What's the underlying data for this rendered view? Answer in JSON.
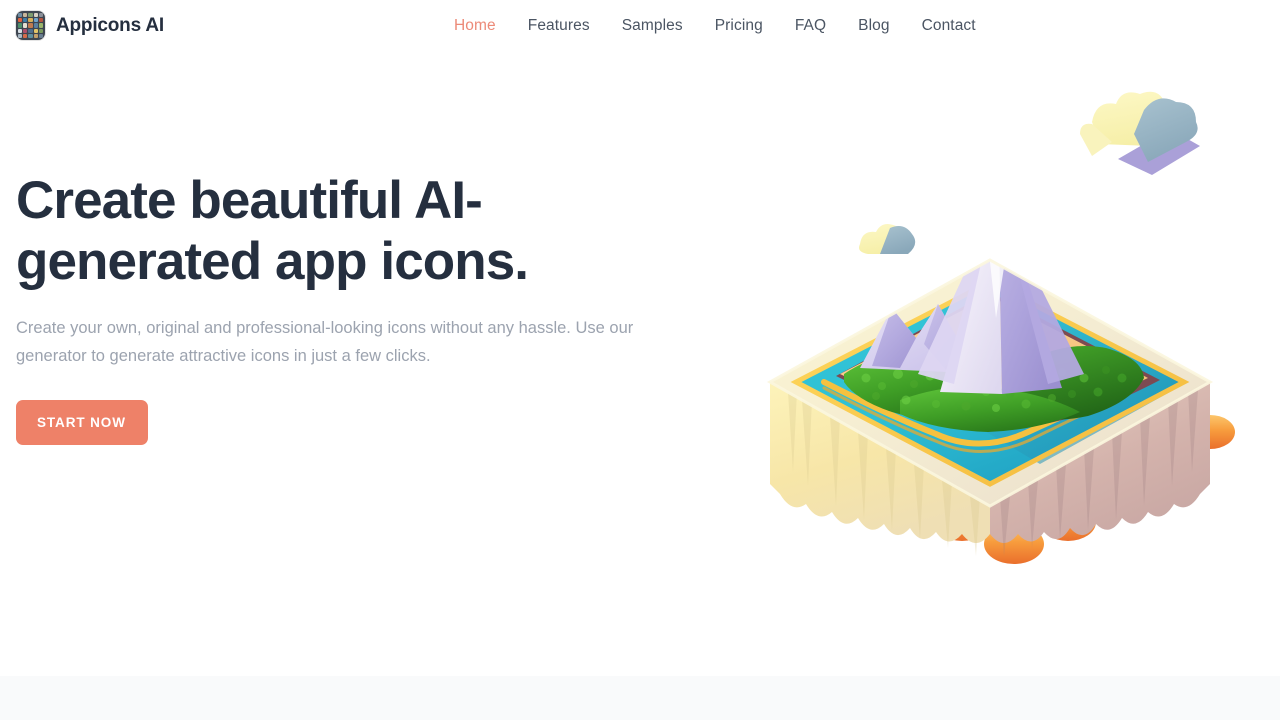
{
  "brand": {
    "name": "Appicons AI",
    "logo_icon": "app-grid-icon",
    "logo_tile_colors": [
      "#6f8fa6",
      "#c9b79a",
      "#7d9b6e",
      "#d9d2c4",
      "#8a8f98",
      "#e0633f",
      "#3f7fa8",
      "#d7b05a",
      "#6fa3c9",
      "#b5553f",
      "#4f8f6b",
      "#e6e0d2",
      "#c07a4f",
      "#5a7fa0",
      "#9ab56b",
      "#d8e0e6",
      "#ab4f6b",
      "#4f6f8f",
      "#e3c56a",
      "#7a9a5f",
      "#a8b8c4",
      "#d46a4a",
      "#5f8f9f",
      "#c4a06a",
      "#6b7f92"
    ]
  },
  "nav": {
    "items": [
      {
        "label": "Home",
        "active": true
      },
      {
        "label": "Features",
        "active": false
      },
      {
        "label": "Samples",
        "active": false
      },
      {
        "label": "Pricing",
        "active": false
      },
      {
        "label": "FAQ",
        "active": false
      },
      {
        "label": "Blog",
        "active": false
      },
      {
        "label": "Contact",
        "active": false
      }
    ]
  },
  "hero": {
    "title": "Create beautiful AI-generated app icons.",
    "subtitle": "Create your own, original and professional-looking icons without any hassle. Use our generator to generate attractive icons in just a few clicks.",
    "cta_label": "START NOW",
    "illustration_name": "isometric-volcano-island-illustration"
  },
  "colors": {
    "accent": "#ee8168",
    "accent_nav_active": "#ec8a78",
    "heading": "#252f3f",
    "body_text": "#9ca3af",
    "nav_text": "#4b5563",
    "page_background": "#ffffff",
    "next_section_background": "#f9fafb"
  }
}
